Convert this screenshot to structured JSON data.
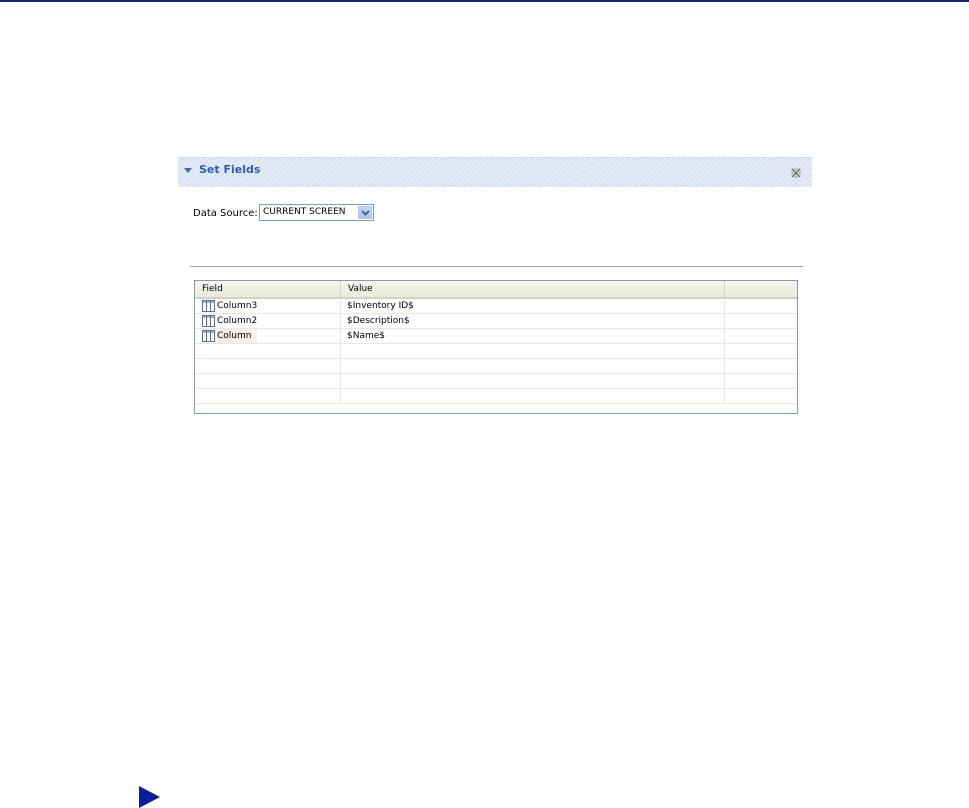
{
  "section": {
    "title": "Set Fields",
    "twisty_icon": "expanded-twisty-icon",
    "close_icon": "close-icon"
  },
  "data_source": {
    "label": "Data Source:",
    "value": "CURRENT SCREEN"
  },
  "grid": {
    "columns": [
      "Field",
      "Value",
      ""
    ],
    "rows": [
      {
        "field": "Column3",
        "value": "$Inventory ID$"
      },
      {
        "field": "Column2",
        "value": "$Description$"
      },
      {
        "field": "Column",
        "value": "$Name$"
      }
    ],
    "empty_row_count": 4
  },
  "colors": {
    "top_rule": "#16237a",
    "header_title": "#2a5db0",
    "nav_arrow": "#0b1e96"
  }
}
